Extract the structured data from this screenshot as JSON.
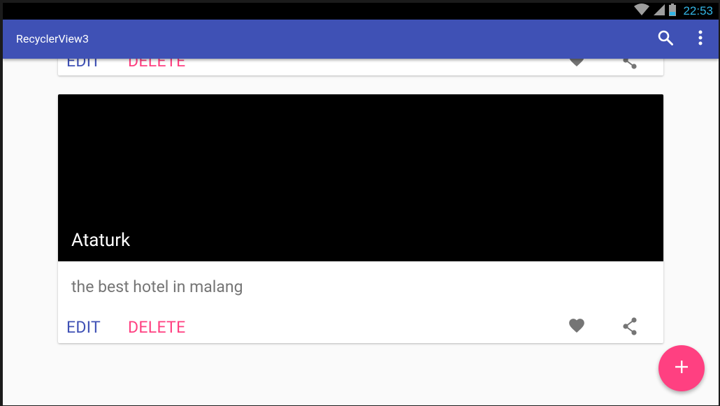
{
  "status_bar": {
    "time": "22:53",
    "icons": [
      "wifi-icon",
      "signal-icon",
      "battery-icon"
    ]
  },
  "app_bar": {
    "title": "RecyclerView3",
    "actions": [
      "search-icon",
      "more-vert-icon"
    ]
  },
  "cards": [
    {
      "title": "",
      "description": "",
      "edit_label": "EDIT",
      "delete_label": "DELETE"
    },
    {
      "title": "Ataturk",
      "description": "the best hotel in malang",
      "edit_label": "EDIT",
      "delete_label": "DELETE"
    }
  ],
  "fab": {
    "icon": "add-icon"
  },
  "colors": {
    "primary": "#3f51b5",
    "accent": "#ff4081",
    "status_time": "#33b5e5",
    "icon_gray": "#757575"
  }
}
